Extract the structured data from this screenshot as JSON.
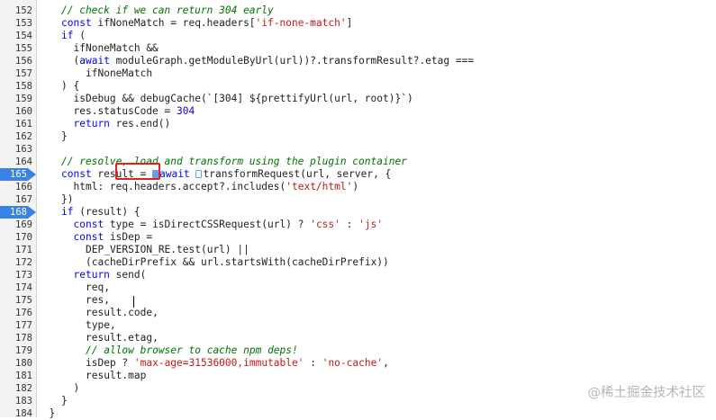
{
  "editor": {
    "lines": [
      {
        "n": "152",
        "i": 2,
        "t": [
          [
            "cm",
            "// check if we can return 304 early"
          ]
        ]
      },
      {
        "n": "153",
        "i": 2,
        "t": [
          [
            "kw2",
            "const"
          ],
          [
            "pl",
            " ifNoneMatch = req.headers["
          ],
          [
            "str",
            "'if-none-match'"
          ],
          [
            "pl",
            "]"
          ]
        ]
      },
      {
        "n": "154",
        "i": 2,
        "t": [
          [
            "kw2",
            "if"
          ],
          [
            "pl",
            " ("
          ]
        ]
      },
      {
        "n": "155",
        "i": 3,
        "t": [
          [
            "pl",
            "ifNoneMatch &&"
          ]
        ]
      },
      {
        "n": "156",
        "i": 3,
        "t": [
          [
            "pl",
            "("
          ],
          [
            "kw2",
            "await"
          ],
          [
            "pl",
            " moduleGraph.getModuleByUrl(url))?.transformResult?.etag ==="
          ]
        ]
      },
      {
        "n": "157",
        "i": 4,
        "t": [
          [
            "pl",
            "ifNoneMatch"
          ]
        ]
      },
      {
        "n": "158",
        "i": 2,
        "t": [
          [
            "pl",
            ") {"
          ]
        ]
      },
      {
        "n": "159",
        "i": 3,
        "t": [
          [
            "pl",
            "isDebug && debugCache(`[304] ${prettifyUrl(url, root)}`)"
          ]
        ]
      },
      {
        "n": "160",
        "i": 3,
        "t": [
          [
            "pl",
            "res.statusCode = "
          ],
          [
            "num",
            "304"
          ]
        ]
      },
      {
        "n": "161",
        "i": 3,
        "t": [
          [
            "kw2",
            "return"
          ],
          [
            "pl",
            " res.end()"
          ]
        ]
      },
      {
        "n": "162",
        "i": 2,
        "t": [
          [
            "pl",
            "}"
          ]
        ]
      },
      {
        "n": "163",
        "i": 0,
        "t": []
      },
      {
        "n": "164",
        "i": 2,
        "t": [
          [
            "cm",
            "// resolve, load and transform using the plugin container"
          ]
        ]
      },
      {
        "n": "165",
        "i": 2,
        "bp": true,
        "t": [
          [
            "kw2",
            "const"
          ],
          [
            "pl",
            " result = "
          ],
          [
            "mk",
            ""
          ],
          [
            "kw2",
            "await"
          ],
          [
            "pl",
            " "
          ],
          [
            "mkh",
            ""
          ],
          [
            "pl",
            "transformRequest(url, server, {"
          ]
        ]
      },
      {
        "n": "166",
        "i": 3,
        "t": [
          [
            "pl",
            "html: req.headers.accept?.includes("
          ],
          [
            "str",
            "'text/html'"
          ],
          [
            "pl",
            ")"
          ]
        ]
      },
      {
        "n": "167",
        "i": 2,
        "t": [
          [
            "pl",
            "})"
          ]
        ]
      },
      {
        "n": "168",
        "i": 2,
        "bp": true,
        "t": [
          [
            "kw2",
            "if"
          ],
          [
            "pl",
            " (result) {"
          ]
        ]
      },
      {
        "n": "169",
        "i": 3,
        "t": [
          [
            "kw2",
            "const"
          ],
          [
            "pl",
            " type = isDirectCSSRequest(url) ? "
          ],
          [
            "str",
            "'css'"
          ],
          [
            "pl",
            " : "
          ],
          [
            "str",
            "'js'"
          ]
        ]
      },
      {
        "n": "170",
        "i": 3,
        "t": [
          [
            "kw2",
            "const"
          ],
          [
            "pl",
            " isDep ="
          ]
        ]
      },
      {
        "n": "171",
        "i": 4,
        "t": [
          [
            "pl",
            "DEP_VERSION_RE.test(url) ||"
          ]
        ]
      },
      {
        "n": "172",
        "i": 4,
        "t": [
          [
            "pl",
            "(cacheDirPrefix && url.startsWith(cacheDirPrefix))"
          ]
        ]
      },
      {
        "n": "173",
        "i": 3,
        "t": [
          [
            "kw2",
            "return"
          ],
          [
            "pl",
            " send("
          ]
        ]
      },
      {
        "n": "174",
        "i": 4,
        "t": [
          [
            "pl",
            "req,"
          ]
        ]
      },
      {
        "n": "175",
        "i": 4,
        "t": [
          [
            "pl",
            "res,"
          ]
        ]
      },
      {
        "n": "176",
        "i": 4,
        "t": [
          [
            "pl",
            "result.code,"
          ]
        ]
      },
      {
        "n": "177",
        "i": 4,
        "t": [
          [
            "pl",
            "type,"
          ]
        ]
      },
      {
        "n": "178",
        "i": 4,
        "t": [
          [
            "pl",
            "result.etag,"
          ]
        ]
      },
      {
        "n": "179",
        "i": 4,
        "t": [
          [
            "cm",
            "// allow browser to cache npm deps!"
          ]
        ]
      },
      {
        "n": "180",
        "i": 4,
        "t": [
          [
            "pl",
            "isDep ? "
          ],
          [
            "str",
            "'max-age=31536000,immutable'"
          ],
          [
            "pl",
            " : "
          ],
          [
            "str",
            "'no-cache'"
          ],
          [
            "pl",
            ","
          ]
        ]
      },
      {
        "n": "181",
        "i": 4,
        "t": [
          [
            "pl",
            "result.map"
          ]
        ]
      },
      {
        "n": "182",
        "i": 3,
        "t": [
          [
            "pl",
            ")"
          ]
        ]
      },
      {
        "n": "183",
        "i": 2,
        "t": [
          [
            "pl",
            "}"
          ]
        ]
      },
      {
        "n": "184",
        "i": 1,
        "t": [
          [
            "pl",
            "}"
          ]
        ]
      }
    ]
  },
  "watermark": "@稀土掘金技术社区",
  "colors": {
    "breakpoint": "#3b82e6",
    "highlight_box": "#e0201e",
    "keyword": "#0000ff",
    "string": "#c41a16",
    "comment": "#007400"
  }
}
